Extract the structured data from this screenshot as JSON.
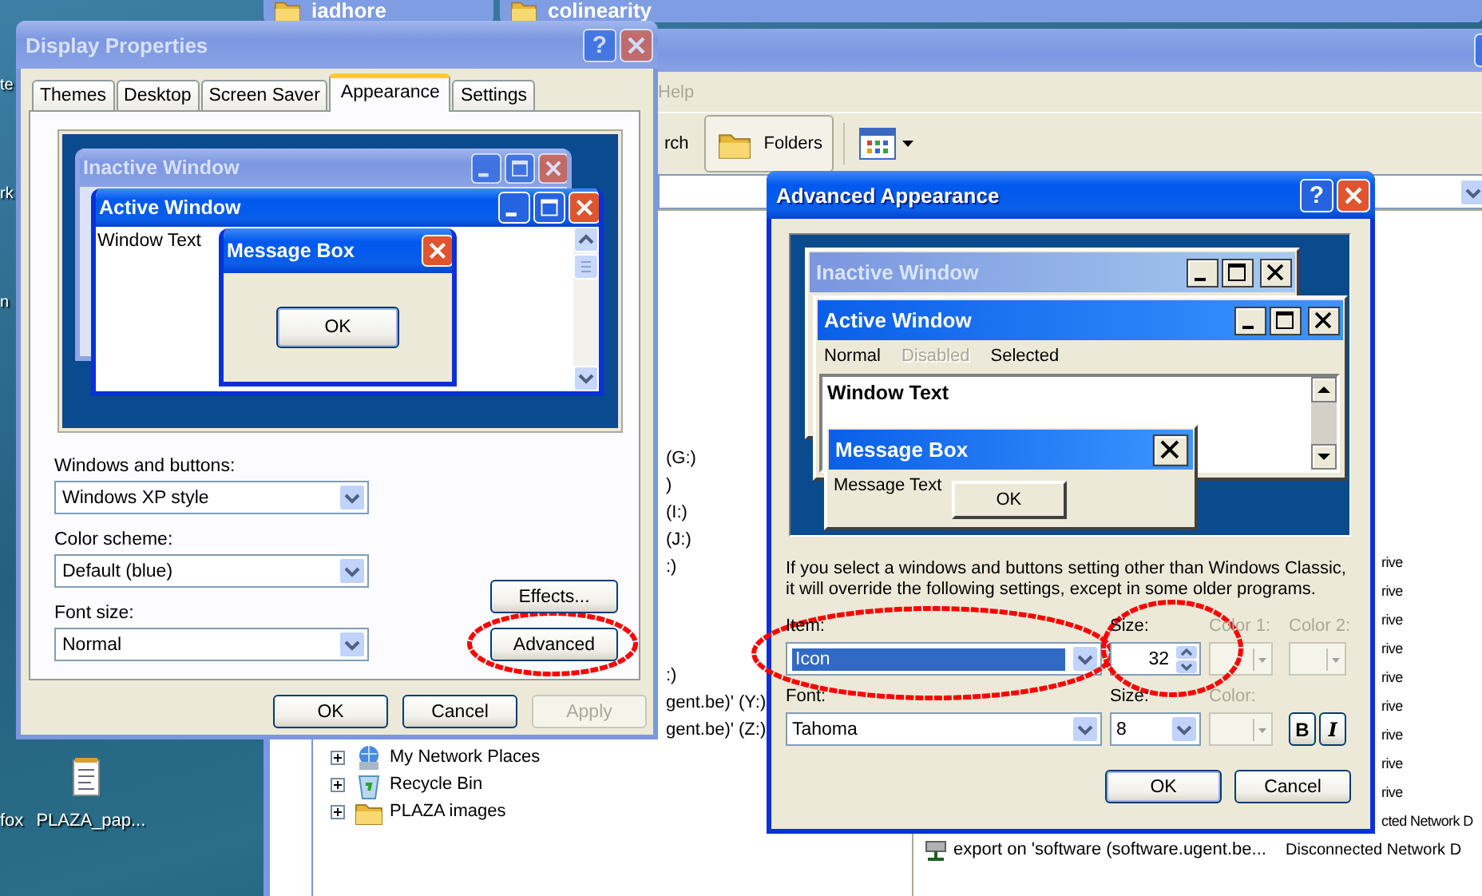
{
  "other_windows": [
    {
      "title": "iadhore"
    },
    {
      "title": "colinearity"
    }
  ],
  "desktop_icons": [
    {
      "label": "te"
    },
    {
      "label": "rk"
    },
    {
      "label": "n"
    }
  ],
  "desktop_bottom": [
    {
      "label": "fox"
    },
    {
      "label": "PLAZA_pap..."
    }
  ],
  "explorer": {
    "menu": [
      "Help"
    ],
    "toolbar": [
      {
        "label": "rch",
        "selected": false
      },
      {
        "label": "Folders",
        "selected": true
      }
    ],
    "tree_cut_upper": [
      "(G:)",
      ")",
      "(I:)",
      "(J:)",
      ":)"
    ],
    "tree_cut_lower": [
      ":)",
      "gent.be)' (Y:)",
      "gent.be)' (Z:)"
    ],
    "tree": [
      {
        "label": "My Network Places",
        "expanded": false,
        "kind": "network"
      },
      {
        "label": "Recycle Bin",
        "expanded": false,
        "kind": "recycle"
      },
      {
        "label": "PLAZA images",
        "expanded": false,
        "kind": "folder"
      }
    ],
    "rows": [
      {
        "type": "rive"
      },
      {
        "type": "rive"
      },
      {
        "type": "rive"
      },
      {
        "type": "rive"
      },
      {
        "type": "rive"
      },
      {
        "type": "rive"
      },
      {
        "type": "rive"
      },
      {
        "type": "rive"
      },
      {
        "type": "rive"
      },
      {
        "type": "cted Network D"
      },
      {
        "name": "export on 'software (software.ugent.be...",
        "type": "Disconnected Network D"
      }
    ]
  },
  "display_properties": {
    "title": "Display Properties",
    "help": "?",
    "tabs": [
      {
        "label": "Themes",
        "selected": false
      },
      {
        "label": "Desktop",
        "selected": false
      },
      {
        "label": "Screen Saver",
        "selected": false
      },
      {
        "label": "Appearance",
        "selected": true
      },
      {
        "label": "Settings",
        "selected": false
      }
    ],
    "preview": {
      "inactive_title": "Inactive Window",
      "active_title": "Active Window",
      "window_text": "Window Text",
      "message_title": "Message Box",
      "message_button": "OK"
    },
    "fields": [
      {
        "label": "Windows and buttons:",
        "value": "Windows XP style"
      },
      {
        "label": "Color scheme:",
        "value": "Default (blue)"
      },
      {
        "label": "Font size:",
        "value": "Normal"
      }
    ],
    "side_buttons": [
      {
        "label": "Effects...",
        "annotated": false
      },
      {
        "label": "Advanced",
        "annotated": true
      }
    ],
    "buttons": [
      {
        "label": "OK",
        "disabled": false
      },
      {
        "label": "Cancel",
        "disabled": false
      },
      {
        "label": "Apply",
        "disabled": true
      }
    ]
  },
  "advanced": {
    "title": "Advanced Appearance",
    "help": "?",
    "preview": {
      "inactive_title": "Inactive Window",
      "active_title": "Active Window",
      "menu": [
        {
          "label": "Normal",
          "disabled": false
        },
        {
          "label": "Disabled",
          "disabled": true
        },
        {
          "label": "Selected",
          "disabled": false
        }
      ],
      "window_text": "Window Text",
      "message_title": "Message Box",
      "message_text": "Message Text",
      "message_button": "OK"
    },
    "note": "If you select a windows and buttons setting other than Windows Classic, it will override the following settings, except in some older programs.",
    "item": {
      "label": "Item:",
      "value": "Icon",
      "highlighted": true,
      "annotated": true
    },
    "item_size": {
      "label": "Size:",
      "value": "32",
      "annotated": true
    },
    "color1": {
      "label": "Color 1:",
      "disabled": true
    },
    "color2": {
      "label": "Color 2:",
      "disabled": true
    },
    "font": {
      "label": "Font:",
      "value": "Tahoma"
    },
    "font_size": {
      "label": "Size:",
      "value": "8"
    },
    "font_color": {
      "label": "Color:",
      "disabled": true
    },
    "bold": {
      "label": "B",
      "selected": false
    },
    "italic": {
      "label": "I",
      "selected": false
    },
    "buttons": [
      {
        "label": "OK",
        "disabled": false
      },
      {
        "label": "Cancel",
        "disabled": false
      }
    ]
  }
}
